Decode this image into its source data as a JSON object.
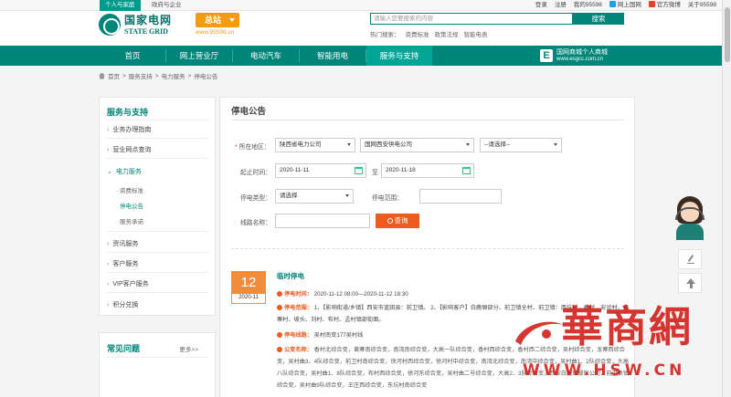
{
  "topbar": {
    "tab_active": "个人与家庭",
    "tab_other": "政府与企业",
    "links": [
      "登录",
      "注册",
      "我的95598",
      "网上国网",
      "官方微博",
      "关于95598"
    ]
  },
  "header": {
    "logo_cn": "国家电网",
    "logo_en": "STATE GRID",
    "site_label": "总站",
    "site_url": "www.95598.cn",
    "search_placeholder": "请输入您要搜索的内容",
    "search_button": "搜索",
    "hot_label": "热门搜索：",
    "hot_items": [
      "资费标准",
      "政策法规",
      "智能电表"
    ]
  },
  "nav": {
    "items": [
      "首页",
      "网上营业厅",
      "电动汽车",
      "智能用电",
      "服务与支持"
    ],
    "active_index": 4,
    "mall_icon": "E",
    "mall_name": "国网商城个人商城",
    "mall_url": "www.esgcc.com.cn"
  },
  "breadcrumb": [
    "首页",
    "服务支持",
    "电力服务",
    "停电公告"
  ],
  "breadcrumb_sep": ">",
  "sidebar": {
    "title": "服务与支持",
    "items": [
      "业务办理指南",
      "营业网点查询",
      "电力服务",
      "资讯服务",
      "客户服务",
      "VIP客户服务",
      "积分兑换"
    ],
    "subitems": [
      "资费标准",
      "停电公告",
      "服务承诺"
    ],
    "active_sub": 1
  },
  "faq": {
    "title": "常见问题",
    "more": "更多>>"
  },
  "main": {
    "title": "停电公告",
    "form": {
      "area_label": "所在地区：",
      "area_province": "陕西省电力公司",
      "area_city": "国网西安供电公司",
      "area_district": "--请选择--",
      "time_label": "起止时间：",
      "time_start": "2020-11-11",
      "time_to": "至",
      "time_end": "2020-11-18",
      "type_label": "停电类型：",
      "type_value": "请选择",
      "range_label": "停电范围：",
      "line_label": "线路名称：",
      "query_button": "查询"
    },
    "notice": {
      "day": "12",
      "year_month": "2020-11",
      "title": "临时停电",
      "time_key": "停电时间：",
      "time_val": "2020-11-12 08:00—2020-11-12 18:30",
      "range_key": "停电范围：",
      "range_val": "1、【影响街道/乡镇】西安市蓝田县：前卫镇。 2、【影响客户】白鹿塬部分、前卫镇全村、前卫镇：西坑村、香村、安岔村、黄寨村、坡头、刘村、布村、孟村镇部街面。",
      "line_key": "停电线路：",
      "line_val": "吴村南变177吴村线",
      "station_key": "公变名称：",
      "station_val": "香村北综合变，黄寨南综合变，南湾南综合变，大高一队综合变，香村西综合变，香村西二综合变，吴村综合变，龙寨西综合变，吴村曲3、4队综合变，前卫村南综合变，徐河村西综合变，徐河村中综合变，南湾北综合变，南湾中综合变，吴村曲1、2队综合变，大高八队综合变，吴村曲1、8队综合变，布村西综合变，徐河东综合变，吴村曲二号综合变，大高2、3队综合变，西安白鹿塬餐饮公司，前卫集镇综合变，吴村曲9队综合变，王庄西综合变，东坑村南综合变"
    }
  },
  "watermark": {
    "cn": "華商網",
    "en": "WWW.HSW.CN"
  },
  "colors": {
    "brand": "#00857a",
    "accent": "#ee5b1f",
    "watermark": "#d2261f"
  }
}
